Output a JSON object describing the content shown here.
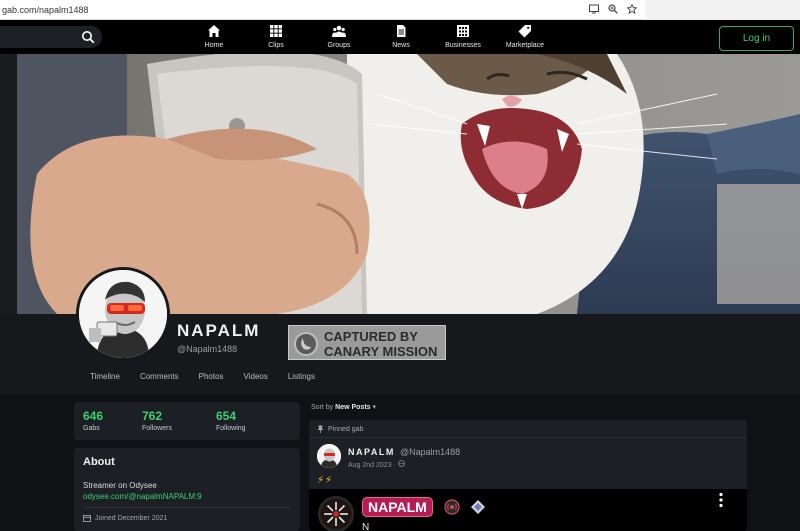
{
  "browser": {
    "url": "gab.com/napalm1488",
    "icons": [
      "screen-share-icon",
      "zoom-icon",
      "star-icon"
    ]
  },
  "nav": {
    "items": [
      {
        "label": "Home",
        "icon": "home-icon"
      },
      {
        "label": "Clips",
        "icon": "grid-icon"
      },
      {
        "label": "Groups",
        "icon": "groups-icon"
      },
      {
        "label": "News",
        "icon": "document-icon"
      },
      {
        "label": "Businesses",
        "icon": "building-icon"
      },
      {
        "label": "Marketplace",
        "icon": "tag-icon"
      }
    ],
    "login_label": "Log in",
    "accent": "#3ecf74"
  },
  "profile": {
    "name": "NAPALM",
    "handle": "@Napalm1488",
    "stamp_line1": "CAPTURED BY",
    "stamp_line2": "CANARY MISSION",
    "tabs": [
      "Timeline",
      "Comments",
      "Photos",
      "Videos",
      "Listings"
    ]
  },
  "stats": [
    {
      "value": "646",
      "label": "Gabs"
    },
    {
      "value": "762",
      "label": "Followers"
    },
    {
      "value": "654",
      "label": "Following"
    }
  ],
  "about": {
    "title": "About",
    "bio": "Streamer on Odysee",
    "link": "odysee.com/@napalmNAPALM:9",
    "joined": "Joined December 2021"
  },
  "feed": {
    "sort_prefix": "Sort by",
    "sort_value": "New Posts",
    "pinned_label": "Pinned gab",
    "post": {
      "author": "NAPALM",
      "handle": "@Napalm1488",
      "date": "Aug 2nd 2023 ·",
      "emoji": "⚡⚡",
      "embed_badge": "NAPALM",
      "embed_text": "N"
    }
  }
}
